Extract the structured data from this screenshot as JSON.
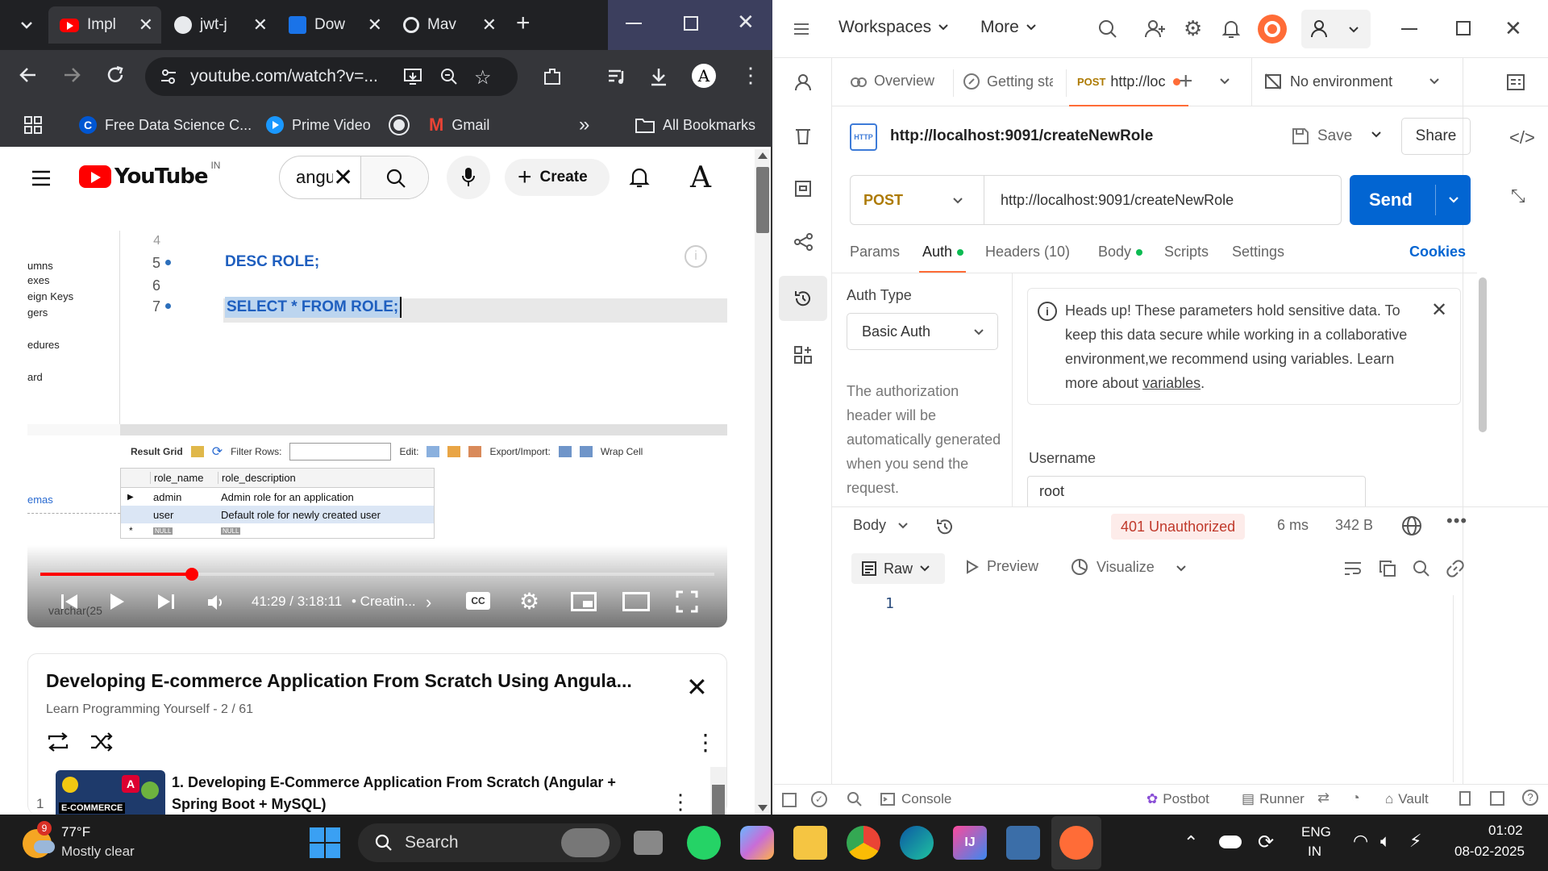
{
  "chrome": {
    "tabs": [
      {
        "label": "Impl"
      },
      {
        "label": "jwt-j"
      },
      {
        "label": "Dow"
      },
      {
        "label": "Mav"
      }
    ],
    "url": "youtube.com/watch?v=...",
    "bookmarks": [
      {
        "label": "Free Data Science C..."
      },
      {
        "label": "Prime Video"
      },
      {
        "label": ""
      },
      {
        "label": "Gmail"
      }
    ],
    "bookmarks_more": "»",
    "all_bookmarks": "All Bookmarks"
  },
  "youtube": {
    "logo_text": "YouTube",
    "country": "IN",
    "search_value": "angu",
    "create_label": "Create",
    "video": {
      "code_lines": [
        {
          "num": "4",
          "text": ""
        },
        {
          "num": "5",
          "text": "DESC ROLE;"
        },
        {
          "num": "6",
          "text": ""
        },
        {
          "num": "7",
          "text": "SELECT * FROM ROLE;"
        }
      ],
      "tree_items": [
        "umns",
        "exes",
        "eign Keys",
        "gers",
        "edures",
        "ard",
        "emas"
      ],
      "grid_toolbar": {
        "result_grid": "Result Grid",
        "filter_rows": "Filter Rows:",
        "edit": "Edit:",
        "export_import": "Export/Import:",
        "wrap_cell": "Wrap Cell"
      },
      "grid_headers": [
        "role_name",
        "role_description"
      ],
      "grid_rows": [
        [
          "admin",
          "Admin role for an application"
        ],
        [
          "user",
          "Default role for newly created user"
        ],
        [
          "NULL",
          "NULL"
        ]
      ],
      "overlay_text": "varchar(25",
      "time": "41:29 / 3:18:11",
      "chapter": "• Creatin...",
      "progress": 0.225,
      "cc_label": "CC"
    },
    "playlist": {
      "title": "Developing E-commerce Application From Scratch Using Angula...",
      "subtitle": "Learn Programming Yourself - 2 / 61",
      "item_index": "1",
      "item_title": "1. Developing E-Commerce Application From Scratch (Angular + Spring Boot + MySQL)",
      "thumb_text": "E-COMMERCE"
    }
  },
  "postman": {
    "menu": {
      "workspaces": "Workspaces",
      "more": "More"
    },
    "tabs": {
      "overview": "Overview",
      "getting_started": "Getting sta",
      "active_method": "POST",
      "active_url": "http://loc",
      "environment": "No environment"
    },
    "request": {
      "icon_text": "HTTP",
      "name": "http://localhost:9091/createNewRole",
      "save": "Save",
      "share": "Share",
      "method": "POST",
      "url": "http://localhost:9091/createNewRole",
      "send": "Send"
    },
    "subtabs": {
      "params": "Params",
      "auth": "Auth",
      "headers": "Headers (10)",
      "body": "Body",
      "scripts": "Scripts",
      "settings": "Settings",
      "cookies": "Cookies"
    },
    "auth": {
      "type_label": "Auth Type",
      "type_value": "Basic Auth",
      "help_text": "The authorization header will be automatically generated when you send the request.",
      "warning_text": "Heads up! These parameters hold sensitive data. To keep this data secure while working in a collaborative environment,we recommend using variables. Learn more about",
      "warning_link": "variables",
      "warning_end": ".",
      "username_label": "Username",
      "username_value": "root"
    },
    "response": {
      "body_label": "Body",
      "status": "401 Unauthorized",
      "time": "6 ms",
      "size": "342 B",
      "raw": "Raw",
      "preview": "Preview",
      "visualize": "Visualize",
      "line_number": "1"
    },
    "statusbar": {
      "console": "Console",
      "postbot": "Postbot",
      "runner": "Runner",
      "vault": "Vault"
    }
  },
  "taskbar": {
    "weather_temp": "77°F",
    "weather_desc": "Mostly clear",
    "weather_badge": "9",
    "search": "Search",
    "lang_top": "ENG",
    "lang_bottom": "IN",
    "time": "01:02",
    "date": "08-02-2025"
  },
  "colors": {
    "youtube_red": "#ff0000",
    "postman_blue": "#0265d2",
    "postman_orange": "#ff6c37",
    "status_red": "#c0392b",
    "auth_dot": "#0cbb52"
  }
}
